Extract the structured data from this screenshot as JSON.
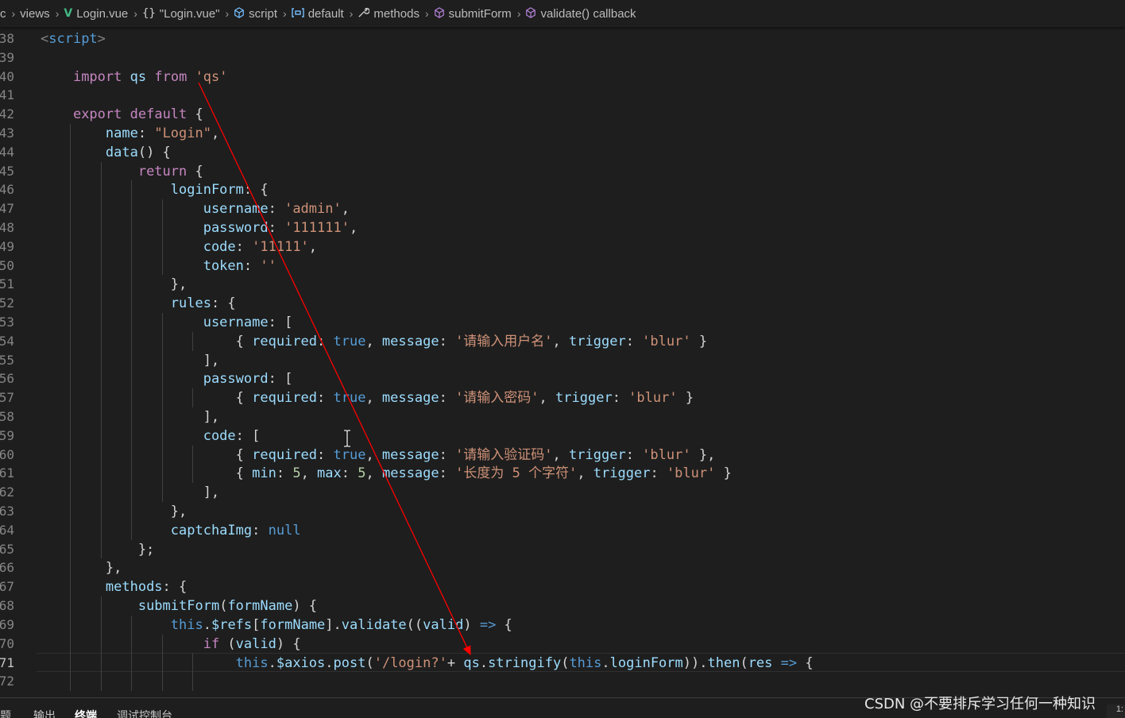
{
  "breadcrumb": {
    "items": [
      {
        "label": "c",
        "icon": ""
      },
      {
        "label": "views",
        "icon": ""
      },
      {
        "label": "Login.vue",
        "icon": "vue-icon"
      },
      {
        "label": "\"Login.vue\"",
        "icon": "braces-icon"
      },
      {
        "label": "script",
        "icon": "cube-icon"
      },
      {
        "label": "default",
        "icon": "variable-icon"
      },
      {
        "label": "methods",
        "icon": "wrench-icon"
      },
      {
        "label": "submitForm",
        "icon": "method-icon"
      },
      {
        "label": "validate() callback",
        "icon": "method-icon"
      }
    ]
  },
  "editor": {
    "lines": [
      {
        "n": "38",
        "text": "<script>"
      },
      {
        "n": "39",
        "text": ""
      },
      {
        "n": "40",
        "text": "    import qs from 'qs'"
      },
      {
        "n": "41",
        "text": ""
      },
      {
        "n": "42",
        "text": "    export default {"
      },
      {
        "n": "43",
        "text": "        name: \"Login\","
      },
      {
        "n": "44",
        "text": "        data() {"
      },
      {
        "n": "45",
        "text": "            return {"
      },
      {
        "n": "46",
        "text": "                loginForm: {"
      },
      {
        "n": "47",
        "text": "                    username: 'admin',"
      },
      {
        "n": "48",
        "text": "                    password: '111111',"
      },
      {
        "n": "49",
        "text": "                    code: '11111',"
      },
      {
        "n": "50",
        "text": "                    token: ''"
      },
      {
        "n": "51",
        "text": "                },"
      },
      {
        "n": "52",
        "text": "                rules: {"
      },
      {
        "n": "53",
        "text": "                    username: ["
      },
      {
        "n": "54",
        "text": "                        { required: true, message: '请输入用户名', trigger: 'blur' }"
      },
      {
        "n": "55",
        "text": "                    ],"
      },
      {
        "n": "56",
        "text": "                    password: ["
      },
      {
        "n": "57",
        "text": "                        { required: true, message: '请输入密码', trigger: 'blur' }"
      },
      {
        "n": "58",
        "text": "                    ],"
      },
      {
        "n": "59",
        "text": "                    code: ["
      },
      {
        "n": "60",
        "text": "                        { required: true, message: '请输入验证码', trigger: 'blur' },"
      },
      {
        "n": "61",
        "text": "                        { min: 5, max: 5, message: '长度为 5 个字符', trigger: 'blur' }"
      },
      {
        "n": "62",
        "text": "                    ],"
      },
      {
        "n": "63",
        "text": "                },"
      },
      {
        "n": "64",
        "text": "                captchaImg: null"
      },
      {
        "n": "65",
        "text": "            };"
      },
      {
        "n": "66",
        "text": "        },"
      },
      {
        "n": "67",
        "text": "        methods: {"
      },
      {
        "n": "68",
        "text": "            submitForm(formName) {"
      },
      {
        "n": "69",
        "text": "                this.$refs[formName].validate((valid) => {"
      },
      {
        "n": "70",
        "text": "                    if (valid) {"
      },
      {
        "n": "71",
        "text": "                        this.$axios.post('/login?'+ qs.stringify(this.loginForm)).then(res => {"
      },
      {
        "n": "72",
        "text": ""
      }
    ],
    "current_line": "71"
  },
  "panel": {
    "tabs": [
      "问题",
      "输出",
      "终端",
      "调试控制台"
    ],
    "active_tab": "终端"
  },
  "watermark": "CSDN @不要排斥学习任何一种知识",
  "status_corner": "1:",
  "colors": {
    "background": "#1e1e1e",
    "keyword": "#c586c0",
    "string": "#ce9178",
    "property": "#9cdcfe",
    "arrow": "#ff0000"
  }
}
